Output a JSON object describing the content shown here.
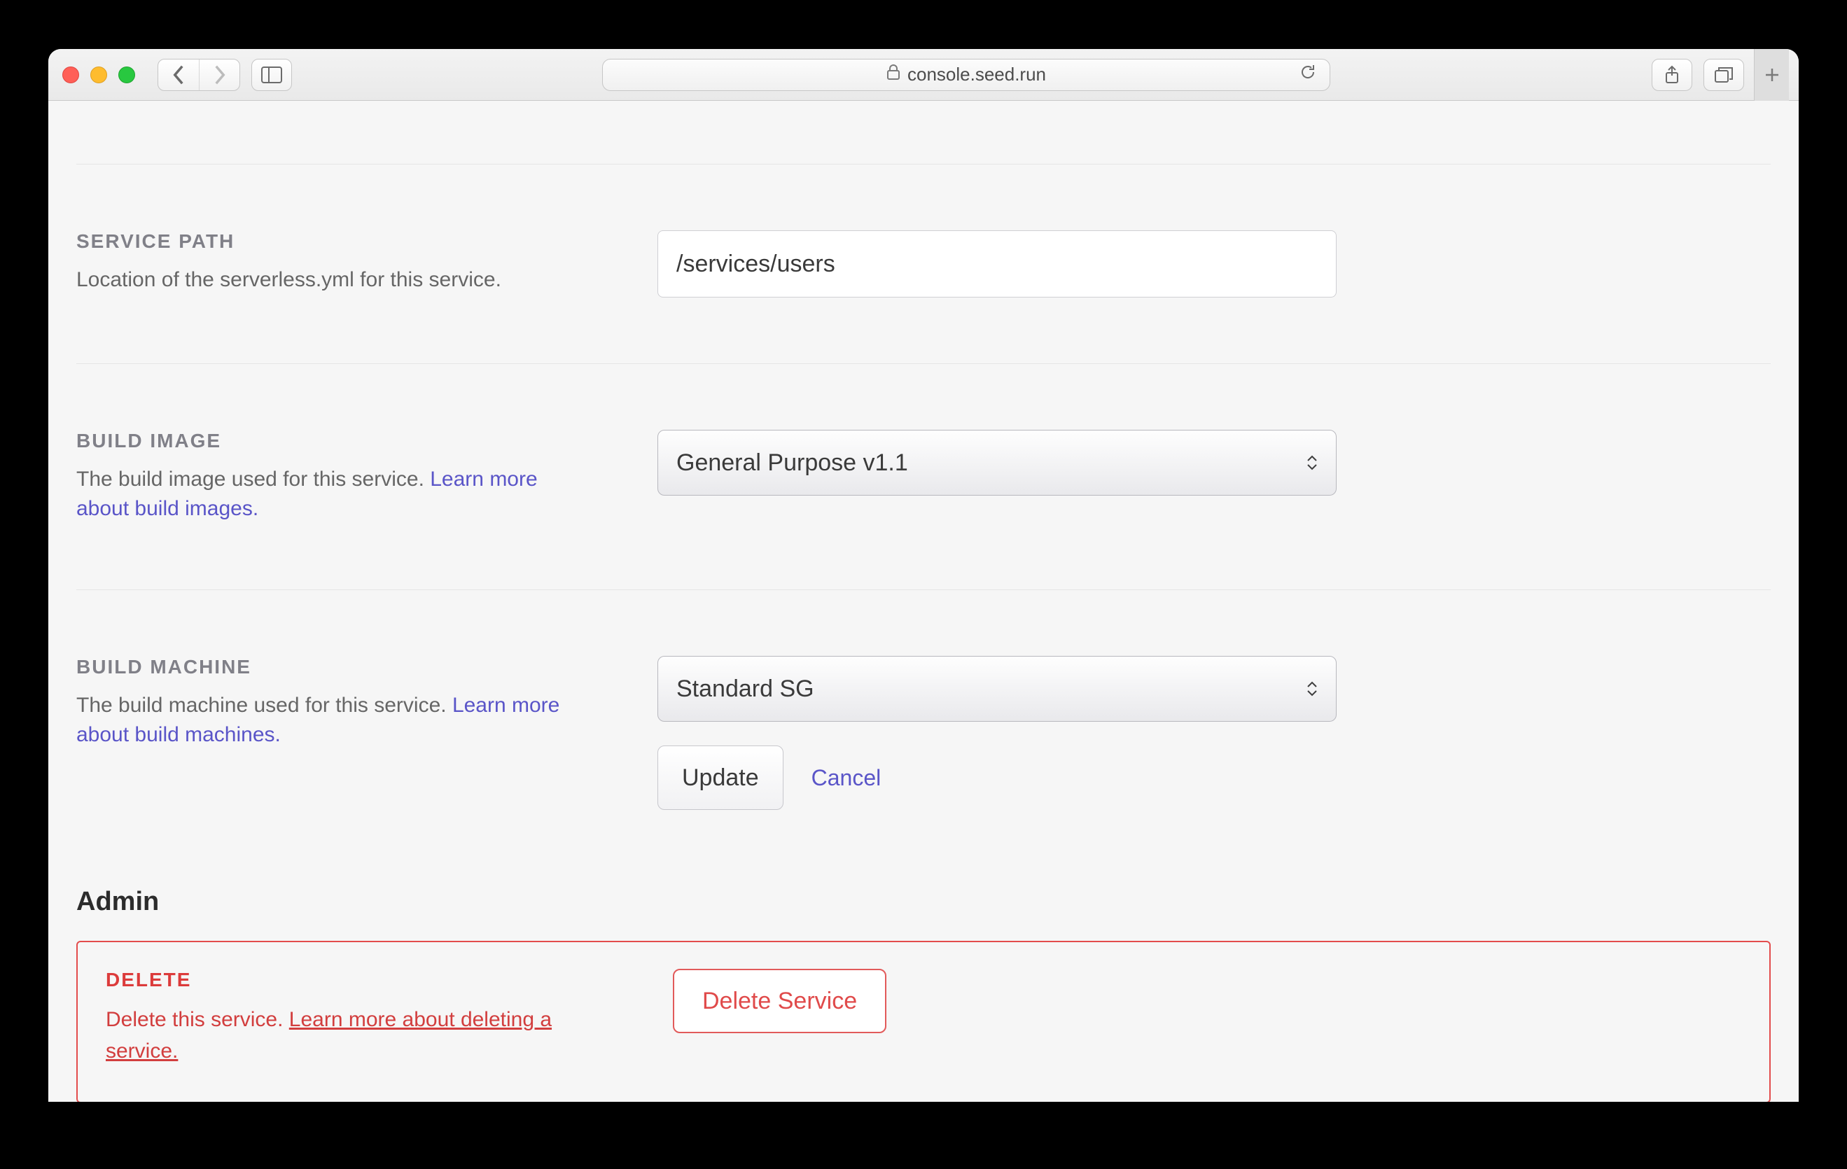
{
  "browser": {
    "url_host": "console.seed.run"
  },
  "service_path": {
    "heading": "SERVICE PATH",
    "desc": "Location of the serverless.yml for this service.",
    "value": "/services/users"
  },
  "build_image": {
    "heading": "BUILD IMAGE",
    "desc_before": "The build image used for this service. ",
    "learn_more": "Learn more about build images.",
    "selected": "General Purpose v1.1"
  },
  "build_machine": {
    "heading": "BUILD MACHINE",
    "desc_before": "The build machine used for this service. ",
    "learn_more": "Learn more about build machines.",
    "selected": "Standard SG",
    "update_label": "Update",
    "cancel_label": "Cancel"
  },
  "admin": {
    "heading": "Admin",
    "delete_heading": "DELETE",
    "delete_desc_before": "Delete this service. ",
    "delete_learn_more": "Learn more about deleting a service.",
    "delete_button": "Delete Service"
  }
}
